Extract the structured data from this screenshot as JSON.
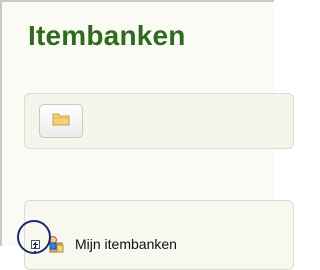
{
  "page": {
    "title": "Itembanken"
  },
  "toolbar": {
    "open_folder_icon": "folder-icon"
  },
  "tree": {
    "items": [
      {
        "label": "Mijn itembanken",
        "icon": "user-bank-icon",
        "expander": "plus"
      }
    ]
  },
  "colors": {
    "title": "#2f6b1d",
    "highlight": "#1d2a6b"
  }
}
